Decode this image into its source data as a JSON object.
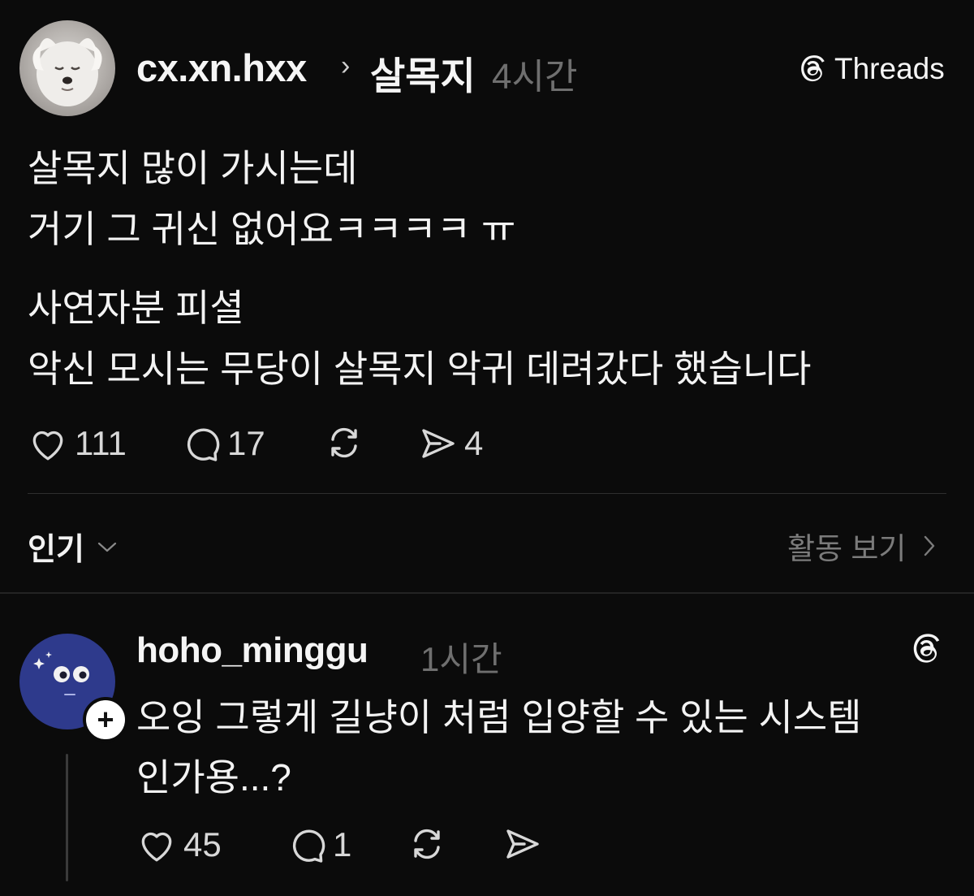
{
  "post": {
    "author": "cx.xn.hxx",
    "community": "살목지",
    "time": "4시간",
    "brand": "Threads",
    "lines": [
      "살목지 많이 가시는데",
      "거기 그 귀신 없어요ㅋㅋㅋㅋ ㅠ",
      "사연자분 피셜",
      "악신 모시는 무당이 살목지 악귀 데려갔다 했습니다"
    ],
    "likes": "111",
    "replies": "17",
    "shares": "4"
  },
  "sort": {
    "label": "인기",
    "activity": "활동 보기"
  },
  "reply": {
    "author": "hoho_minggu",
    "time": "1시간",
    "lines": [
      "오잉 그렇게 길냥이 처럼 입양할 수 있는 시스템",
      "인가용...?"
    ],
    "likes": "45",
    "replies": "1"
  },
  "icons": {
    "like": "heart-icon",
    "reply": "comment-icon",
    "repost": "repost-icon",
    "share": "send-icon",
    "brand": "threads-logo-icon",
    "chevron": "chevron-right-icon",
    "dropdown": "chevron-down-icon",
    "plus": "plus-icon"
  },
  "colors": {
    "background": "#0b0b0b",
    "text": "#f3f3f3",
    "muted": "#6f6f6f",
    "avatar_reply": "#2e3a8c"
  }
}
